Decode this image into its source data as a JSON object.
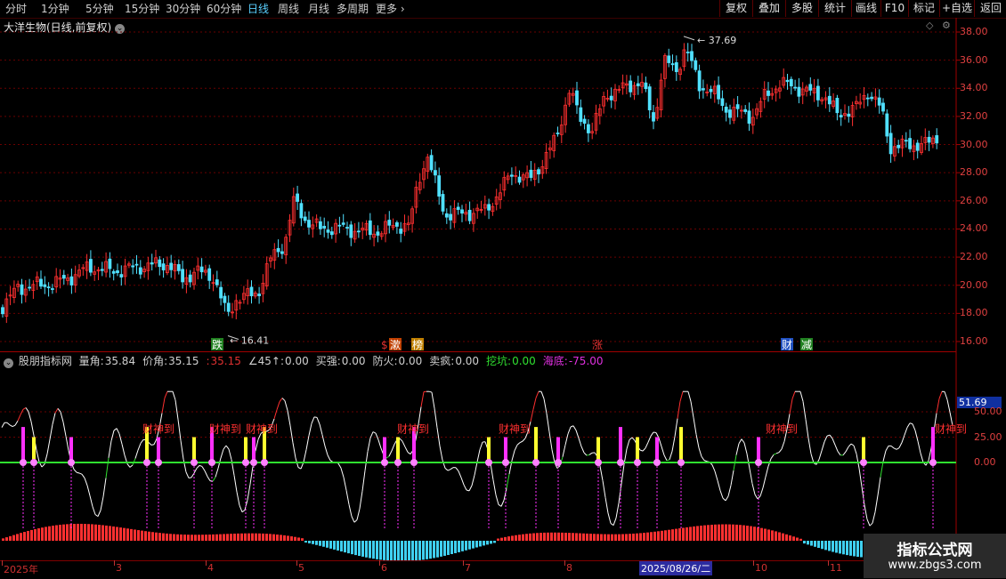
{
  "toolbar": {
    "periods": [
      "分时",
      "1分钟",
      "5分钟",
      "15分钟",
      "30分钟",
      "60分钟",
      "日线",
      "周线",
      "月线",
      "多周期",
      "更多"
    ],
    "active_period": "日线",
    "buttons": [
      "复权",
      "叠加",
      "多股",
      "统计",
      "画线",
      "F10",
      "标记",
      "+自选",
      "返回"
    ]
  },
  "main_chart": {
    "title": "大洋生物(日线,前复权)",
    "high_label": "37.69",
    "low_label": "16.41",
    "signals": [
      "跌",
      "$",
      "漱",
      "榜",
      "涨",
      "财",
      "减"
    ],
    "price_ticks": [
      "38.00",
      "36.00",
      "34.00",
      "32.00",
      "30.00",
      "28.00",
      "26.00",
      "24.00",
      "22.00",
      "20.00",
      "18.00",
      "16.00"
    ]
  },
  "indicator": {
    "name": "股朋指标网",
    "fields": [
      {
        "label": "量角:",
        "value": "35.84",
        "color": "#d0d0d0"
      },
      {
        "label": "价角:",
        "value": "35.15",
        "color": "#d0d0d0"
      },
      {
        "label": ":",
        "value": "35.15",
        "color": "#e03030"
      },
      {
        "label": "∠45↑:",
        "value": "0.00",
        "color": "#d0d0d0"
      },
      {
        "label": "买强:",
        "value": "0.00",
        "color": "#d0d0d0"
      },
      {
        "label": "防火:",
        "value": "0.00",
        "color": "#d0d0d0"
      },
      {
        "label": "卖疯:",
        "value": "0.00",
        "color": "#d0d0d0"
      },
      {
        "label": "挖坑:",
        "value": "0.00",
        "color": "#30e030"
      },
      {
        "label": "海底:",
        "value": "-75.00",
        "color": "#e030e0"
      }
    ],
    "current_label": "51.69",
    "ticks": [
      "50.00",
      "25.00",
      "0.00"
    ],
    "signal_text": "财神到"
  },
  "date_axis": {
    "labels": [
      "2025年",
      "3",
      "4",
      "5",
      "6",
      "7",
      "8",
      "10",
      "11"
    ],
    "cursor_date": "2025/08/26/二"
  },
  "watermark": {
    "title": "指标公式网",
    "url": "www.zbgs3.com"
  },
  "colors": {
    "up": "#ff3030",
    "down": "#50e0ff",
    "grid": "#6a0000",
    "magenta": "#ff30ff",
    "yellow": "#ffff30",
    "green": "#30e030"
  }
}
